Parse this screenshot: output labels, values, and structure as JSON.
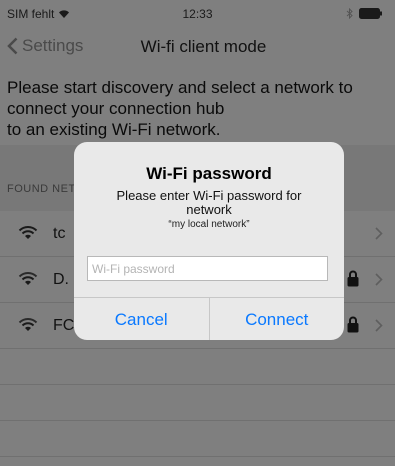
{
  "status": {
    "carrier": "SIM fehlt",
    "time": "12:33"
  },
  "nav": {
    "back_label": "Settings",
    "title": "Wi-fi client mode"
  },
  "intro": {
    "line1": "Please start discovery and select a network to",
    "line2": "connect your connection hub",
    "line3": "to an existing Wi-Fi  network."
  },
  "section": {
    "header": "FOUND NETWORKS"
  },
  "networks": [
    {
      "name": "tc",
      "locked": false
    },
    {
      "name": "D.",
      "locked": true
    },
    {
      "name": "FC",
      "locked": true
    }
  ],
  "dialog": {
    "title": "Wi-Fi password",
    "message_line1": "Please enter Wi-Fi password for",
    "message_line2": "network",
    "network_name": "“my local network”",
    "input_placeholder": "Wi-Fi password",
    "cancel_label": "Cancel",
    "connect_label": "Connect"
  },
  "colors": {
    "accent": "#0a79ff",
    "dim": "#7f7f7f"
  }
}
